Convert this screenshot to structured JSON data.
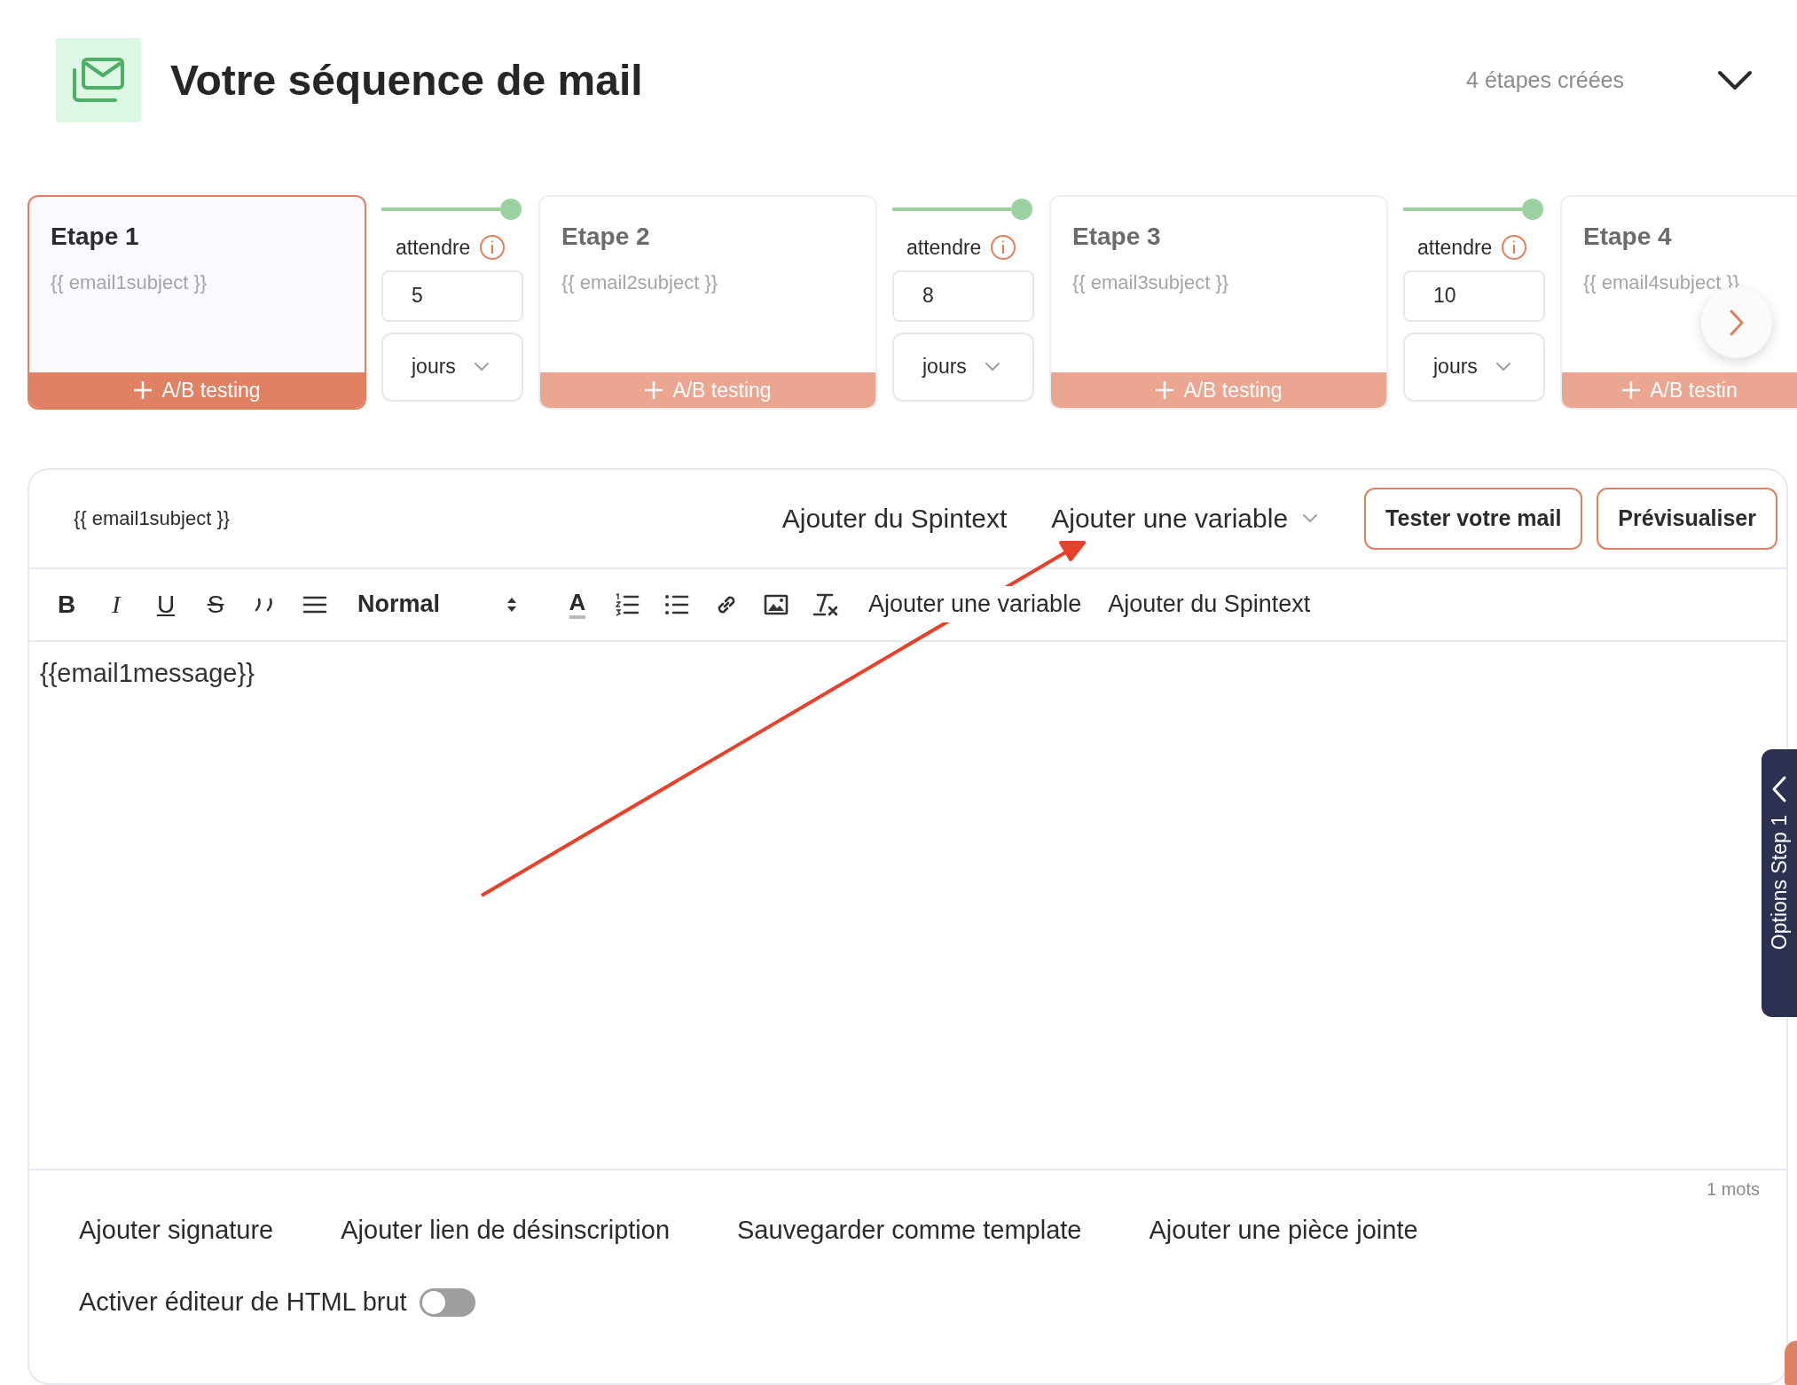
{
  "header": {
    "title": "Votre séquence de mail",
    "count": "4 étapes créées"
  },
  "steps": [
    {
      "title": "Etape 1",
      "subject": "{{ email1subject }}",
      "ab_label": "A/B testing",
      "selected": true
    },
    {
      "title": "Etape 2",
      "subject": "{{ email2subject }}",
      "ab_label": "A/B testing",
      "selected": false
    },
    {
      "title": "Etape 3",
      "subject": "{{ email3subject }}",
      "ab_label": "A/B testing",
      "selected": false
    },
    {
      "title": "Etape 4",
      "subject": "{{ email4subject }}",
      "ab_label": "A/B testin",
      "selected": false
    }
  ],
  "waits": [
    {
      "label": "attendre",
      "value": "5",
      "unit": "jours"
    },
    {
      "label": "attendre",
      "value": "8",
      "unit": "jours"
    },
    {
      "label": "attendre",
      "value": "10",
      "unit": "jours"
    }
  ],
  "editor": {
    "subject": "{{ email1subject }}",
    "spintext": "Ajouter du Spintext",
    "variable": "Ajouter une variable",
    "test_button": "Tester votre mail",
    "preview_button": "Prévisualiser",
    "toolbar": [
      {
        "kind": "bold",
        "text": "B"
      },
      {
        "kind": "italic",
        "text": "I"
      },
      {
        "kind": "underline",
        "text": "U"
      },
      {
        "kind": "strike",
        "text": "S"
      },
      {
        "kind": "quote"
      },
      {
        "kind": "align"
      },
      {
        "kind": "heading",
        "text": "Normal"
      },
      {
        "kind": "color",
        "text": "A"
      },
      {
        "kind": "ordered"
      },
      {
        "kind": "bullet"
      },
      {
        "kind": "link"
      },
      {
        "kind": "image"
      },
      {
        "kind": "clean"
      },
      {
        "kind": "text",
        "text": "Ajouter une variable"
      },
      {
        "kind": "text",
        "text": "Ajouter du Spintext"
      }
    ],
    "message": "{{email1message}}",
    "word_count": "1 mots",
    "actions": [
      "Ajouter signature",
      "Ajouter lien de désinscription",
      "Sauvegarder comme template",
      "Ajouter une pièce jointe"
    ],
    "raw_html": {
      "label": "Activer éditeur de HTML brut",
      "on": false
    }
  },
  "side_tab": {
    "label": "Options Step 1"
  }
}
